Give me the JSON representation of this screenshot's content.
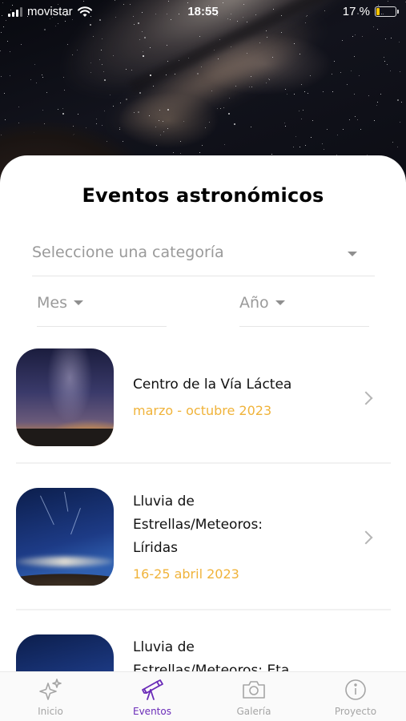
{
  "status_bar": {
    "carrier": "movistar",
    "time": "18:55",
    "battery": "17 %"
  },
  "header": {
    "title": "Eventos astronómicos"
  },
  "filters": {
    "category_placeholder": "Seleccione una categoría",
    "month_placeholder": "Mes",
    "year_placeholder": "Año"
  },
  "events": [
    {
      "title_lines": [
        "Centro de la Vía Láctea"
      ],
      "date": "marzo - octubre 2023"
    },
    {
      "title_lines": [
        "Lluvia de",
        "Estrellas/Meteoros:",
        "Líridas"
      ],
      "date": "16-25 abril 2023"
    },
    {
      "title_lines": [
        "Lluvia de",
        "Estrellas/Meteoros: Eta"
      ],
      "date": ""
    }
  ],
  "tabs": [
    {
      "label": "Inicio",
      "icon": "sparkles-icon",
      "active": false
    },
    {
      "label": "Eventos",
      "icon": "telescope-icon",
      "active": true
    },
    {
      "label": "Galería",
      "icon": "camera-icon",
      "active": false
    },
    {
      "label": "Proyecto",
      "icon": "info-icon",
      "active": false
    }
  ],
  "colors": {
    "accent": "#6a2bb8",
    "date": "#f0b33a"
  }
}
